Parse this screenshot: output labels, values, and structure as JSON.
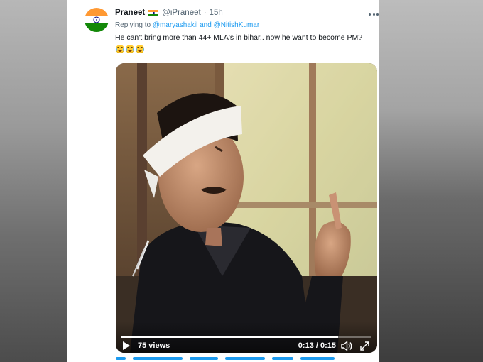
{
  "tweet": {
    "author": {
      "display_name": "Praneet",
      "handle": "@iPraneet",
      "separator": "·",
      "timestamp": "15h",
      "avatar_icon": "india-flag-avatar-icon",
      "verified_emoji_icon": "india-flag-icon"
    },
    "replying": {
      "prefix": "Replying to",
      "mention_1": "@maryashakil",
      "conjunction": "and",
      "mention_2": "@NitishKumar"
    },
    "text": "He can't bring more than 44+ MLA's in bihar.. now he want to become PM?",
    "emoji_icons": [
      "face-with-tears-of-joy-icon",
      "face-with-tears-of-joy-icon",
      "face-with-tears-of-joy-icon"
    ],
    "menu_icon": "more-horizontal-icon"
  },
  "video": {
    "views": "75 views",
    "time": "0:13 / 0:15",
    "progress_fraction": 0.8667,
    "play_icon": "play-icon",
    "volume_icon": "volume-icon",
    "expand_icon": "expand-icon"
  },
  "colors": {
    "link": "#1d9bf0",
    "primary_text": "#0f1419",
    "secondary_text": "#536471"
  }
}
